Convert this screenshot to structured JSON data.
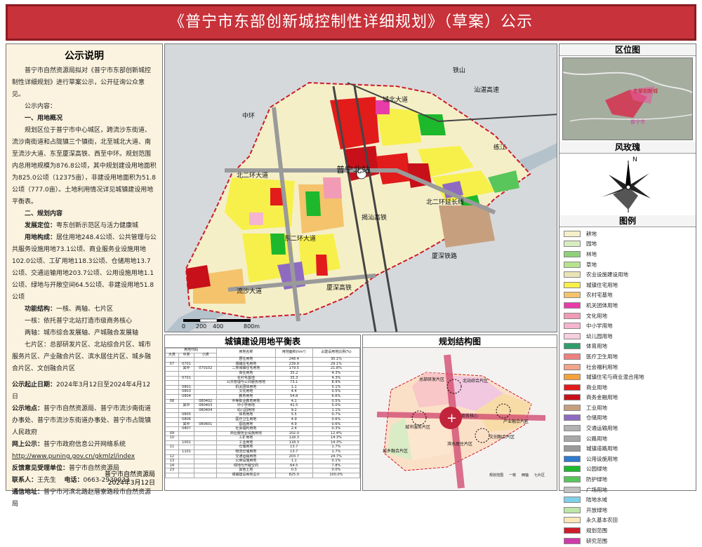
{
  "header": {
    "title": "《普宁市东部创新城控制性详细规划》（草案）公示"
  },
  "notice": {
    "title": "公示说明",
    "intro": "普宁市自然资源局拟对《普宁市东部创新城控制性详细规划》进行草案公示，公开征询公众意见。",
    "content_label": "公示内容：",
    "s1_title": "一、用地概况",
    "s1_text": "规划区位于普宁市中心城区，跨流沙东街道、流沙南街道和占陇镇三个镇街，北至城北大道、南至流沙大道、东至厦深高铁、西至中环。规划范围内总用地规模为876.8公顷，其中规划建设用地面积为825.0公顷（12375亩），非建设用地面积为51.8公顷（777.0亩）。土地利用情况详见城镇建设用地平衡表。",
    "s2_title": "二、规划内容",
    "pos_label": "发展定位：",
    "pos_text": "粤东创新示范区与活力健康城",
    "land_label": "用地构成：",
    "land_text": "居住用地248.4公顷、公共管理与公共服务设施用地73.1公顷、商业服务业设施用地102.0公顷、工矿用地118.3公顷、仓储用地13.7公顷、交通运输用地203.7公顷、公用设施用地1.1公顷、绿地与开敞空间64.5公顷、非建设用地51.8公顷",
    "func_label": "功能结构：",
    "func_text": "一核、两轴、七片区",
    "core": "一核：依托普宁北站打造市级商务核心",
    "axis": "两轴：城市综合发展轴、产城融合发展轴",
    "zones": "七片区：总部研发片区、北站综合片区、城市服务片区、产业融合片区、滨水居住片区、城乡融合片区、文创融合片区",
    "time_label": "公示起止日期：",
    "time_text": "2024年3月12日至2024年4月12日",
    "place_label": "公示地点：",
    "place_text": "普宁市自然资源局、普宁市流沙南街道办事处、普宁市流沙东街道办事处、普宁市占陇镇人民政府",
    "web_label": "网上公示：",
    "web_text": "普宁市政府信息公开网络系统",
    "url": "http://www.puning.gov.cn/gkmlzl/index",
    "fb_label": "反馈意见受理单位：",
    "fb_text": "普宁市自然资源局",
    "contact_label": "联系人：",
    "contact_name": "王先生",
    "phone_label": "电话：",
    "phone": "0663-2939933",
    "mail_label": "通信地址：",
    "mail_text": "普宁市河滨北路赵厝寮路段市自然资源局",
    "sign_org": "普宁市自然资源局",
    "sign_date": "2024年3月12日"
  },
  "map": {
    "labels": {
      "tieshan": "铁山",
      "shantan": "汕湛高速",
      "chengbei": "城北大道",
      "lianjiang": "练江",
      "zhonghuan": "中环",
      "beierhuan": "北二环大道",
      "puning_north": "普宁北站",
      "beierhuan_ext": "北二环延长线",
      "dongerhuan": "东二环大道",
      "xiashen": "厦深铁路",
      "liusha": "流沙大道",
      "xiashen_hsr": "厦深高铁",
      "jieda_hsr": "揭汕高铁"
    },
    "scale": {
      "s0": "0",
      "s200": "200",
      "s400": "400",
      "s800": "800m"
    }
  },
  "right": {
    "loc_title": "区位图",
    "rose_title": "风玫瑰",
    "north": "N",
    "legend_title": "图例",
    "loc_labels": {
      "zone": "东部创新城",
      "city": "普宁市"
    }
  },
  "legend": [
    {
      "label": "耕地",
      "color": "#f5f0c9"
    },
    {
      "label": "园地",
      "color": "#d8ecc1"
    },
    {
      "label": "林地",
      "color": "#8fd17a"
    },
    {
      "label": "草地",
      "color": "#b7e38d"
    },
    {
      "label": "农业设施建设用地",
      "color": "#e9e4b5"
    },
    {
      "label": "城镇住宅用地",
      "color": "#f7f04a"
    },
    {
      "label": "农村宅基地",
      "color": "#f4c36c"
    },
    {
      "label": "机关团体用地",
      "color": "#e83ca8"
    },
    {
      "label": "文化用地",
      "color": "#f29bb6"
    },
    {
      "label": "中小学用地",
      "color": "#f5b5d0"
    },
    {
      "label": "幼儿园用地",
      "color": "#f6cfe0"
    },
    {
      "label": "体育用地",
      "color": "#2f9d6a"
    },
    {
      "label": "医疗卫生用地",
      "color": "#ee8080"
    },
    {
      "label": "社会福利用地",
      "color": "#f1a48a"
    },
    {
      "label": "城镇住宅与商业混合用地",
      "color": "#f3a33a"
    },
    {
      "label": "商业用地",
      "color": "#e21b1b"
    },
    {
      "label": "商务金融用地",
      "color": "#c8101a"
    },
    {
      "label": "工业用地",
      "color": "#c6a07e"
    },
    {
      "label": "仓储用地",
      "color": "#8e6bc1"
    },
    {
      "label": "交通运输用地",
      "color": "#b2b2b2"
    },
    {
      "label": "公路用地",
      "color": "#a8a8a8"
    },
    {
      "label": "城镇道路用地",
      "color": "#9a9a9a"
    },
    {
      "label": "公用设施用地",
      "color": "#2e7bd0"
    },
    {
      "label": "公园绿地",
      "color": "#1eb82c"
    },
    {
      "label": "防护绿地",
      "color": "#58c65a"
    },
    {
      "label": "广场用地",
      "color": "#c0c0c0"
    },
    {
      "label": "陆地水域",
      "color": "#7ed1e8"
    },
    {
      "label": "开放绿地",
      "color": "#bde6a8"
    },
    {
      "label": "永久基本农田",
      "color": "#fae7b8"
    },
    {
      "label": "规划范围",
      "color": "#cc1c2a"
    },
    {
      "label": "研究范围",
      "color": "#d03aa8"
    }
  ],
  "table": {
    "title": "城镇建设用地平衡表",
    "head": {
      "code": "用地代码",
      "big": "大类",
      "mid": "中类",
      "small": "小类",
      "name": "用地名称",
      "area": "用地面积(hm²)",
      "ratio": "占建设用地比例(%)"
    },
    "rows": [
      [
        "",
        "",
        "",
        "居住用地",
        "248.4",
        "30.1%"
      ],
      [
        "07",
        "0701",
        "",
        "城镇住宅用地",
        "239.9",
        "29.1%"
      ],
      [
        "",
        "其中",
        "070102",
        "二类城镇住宅用地",
        "179.5",
        "21.8%"
      ],
      [
        "",
        "",
        "",
        "商住用地",
        "35.2",
        "4.3%"
      ],
      [
        "",
        "0701",
        "",
        "农村宅基地",
        "35.3",
        "4.3%"
      ],
      [
        "",
        "",
        "",
        "公共管理与公共服务用地",
        "73.1",
        "8.9%"
      ],
      [
        "",
        "0801",
        "",
        "机关团体用地",
        "1.1",
        "0.1%"
      ],
      [
        "",
        "0803",
        "",
        "文化用地",
        "4.4",
        "0.5%"
      ],
      [
        "",
        "0804",
        "",
        "教育用地",
        "54.8",
        "6.6%"
      ],
      [
        "08",
        "",
        "080402",
        "中等职业教育用地",
        "4.1",
        "0.5%"
      ],
      [
        "",
        "其中",
        "080403",
        "中小学用地",
        "41.5",
        "5.0%"
      ],
      [
        "",
        "",
        "080404",
        "幼儿园用地",
        "9.2",
        "1.1%"
      ],
      [
        "",
        "0805",
        "",
        "体育用地",
        "5.5",
        "0.7%"
      ],
      [
        "",
        "0806",
        "",
        "医疗卫生用地",
        "4.9",
        "0.6%"
      ],
      [
        "",
        "其中",
        "080601",
        "医院用地",
        "4.9",
        "0.6%"
      ],
      [
        "",
        "0807",
        "",
        "社会福利用地",
        "2.4",
        "0.3%"
      ],
      [
        "09",
        "",
        "",
        "商业服务业设施用地",
        "102.0",
        "12.4%"
      ],
      [
        "10",
        "",
        "",
        "工矿用地",
        "118.3",
        "14.3%"
      ],
      [
        "",
        "1001",
        "",
        "工业用地",
        "118.3",
        "14.3%"
      ],
      [
        "11",
        "",
        "",
        "仓储用地",
        "13.7",
        "1.7%"
      ],
      [
        "",
        "1101",
        "",
        "物流仓储用地",
        "13.7",
        "1.7%"
      ],
      [
        "12",
        "",
        "",
        "交通运输用地",
        "203.7",
        "24.7%"
      ],
      [
        "13",
        "",
        "",
        "公用设施用地",
        "1.1",
        "0.1%"
      ],
      [
        "14",
        "",
        "",
        "绿地与开敞空间",
        "64.5",
        "7.8%"
      ],
      [
        "23",
        "",
        "",
        "其他土地",
        "0.3",
        "0.0%"
      ],
      [
        "",
        "",
        "",
        "城镇建设用地总计",
        "825.0",
        "100.0%"
      ]
    ]
  },
  "structure": {
    "title": "规划结构图",
    "labels": {
      "hq": "总部研发片区",
      "north_station": "北站综合片区",
      "city_service": "城市服务片区",
      "industry": "产业融合片区",
      "core": "商务核心",
      "river": "滨水居住片区",
      "rural": "城乡融合片区",
      "culture": "文创融合片区"
    },
    "legend": [
      "规划范围",
      "一核",
      "两轴",
      "七片区"
    ]
  }
}
